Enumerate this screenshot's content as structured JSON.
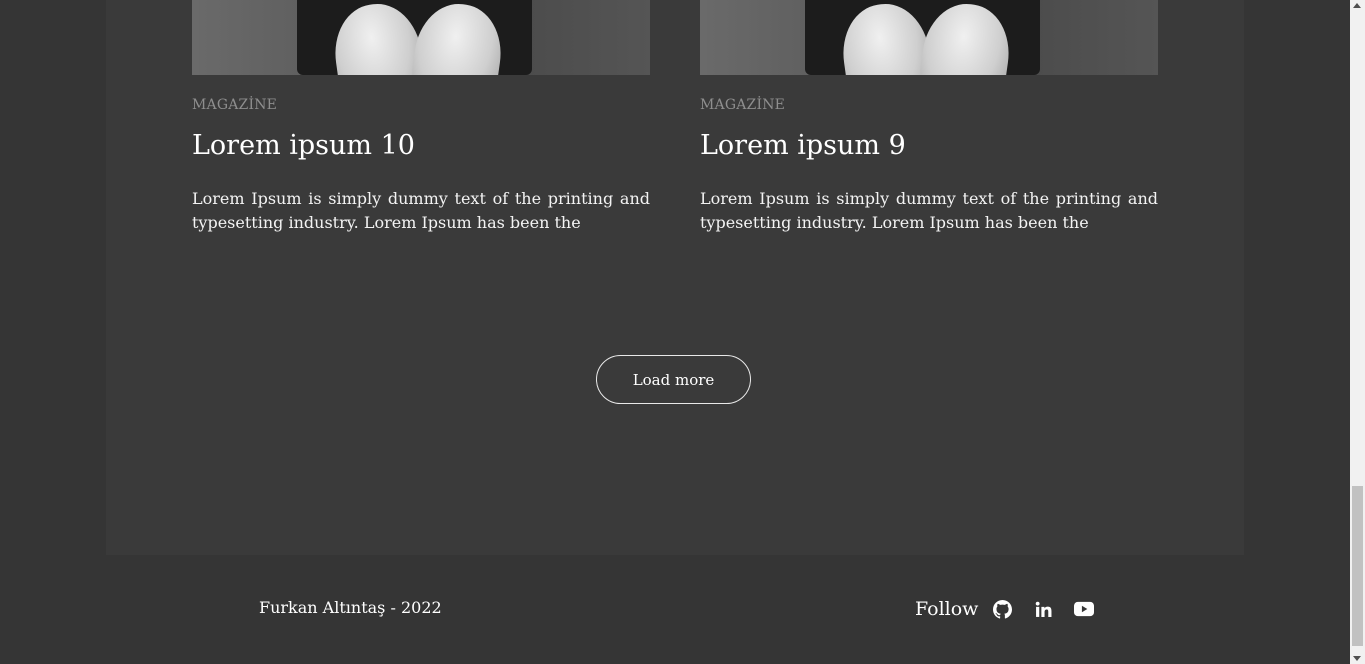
{
  "posts": [
    {
      "category": "MAGAZİNE",
      "title": "Lorem ipsum 10",
      "excerpt": "Lorem Ipsum is simply dummy text of the printing and typesetting industry. Lorem Ipsum has been the"
    },
    {
      "category": "MAGAZİNE",
      "title": "Lorem ipsum 9",
      "excerpt": "Lorem Ipsum is simply dummy text of the printing and typesetting industry. Lorem Ipsum has been the"
    }
  ],
  "load_more_label": "Load more",
  "footer": {
    "copyright": "Furkan Altıntaş - 2022",
    "follow_label": "Follow",
    "social": [
      {
        "name": "github-icon"
      },
      {
        "name": "linkedin-icon"
      },
      {
        "name": "youtube-icon"
      }
    ]
  },
  "colors": {
    "page_background": "#353535",
    "panel_background": "#3a3a3a",
    "text": "#ffffff",
    "muted_text": "#8e8e8e"
  }
}
